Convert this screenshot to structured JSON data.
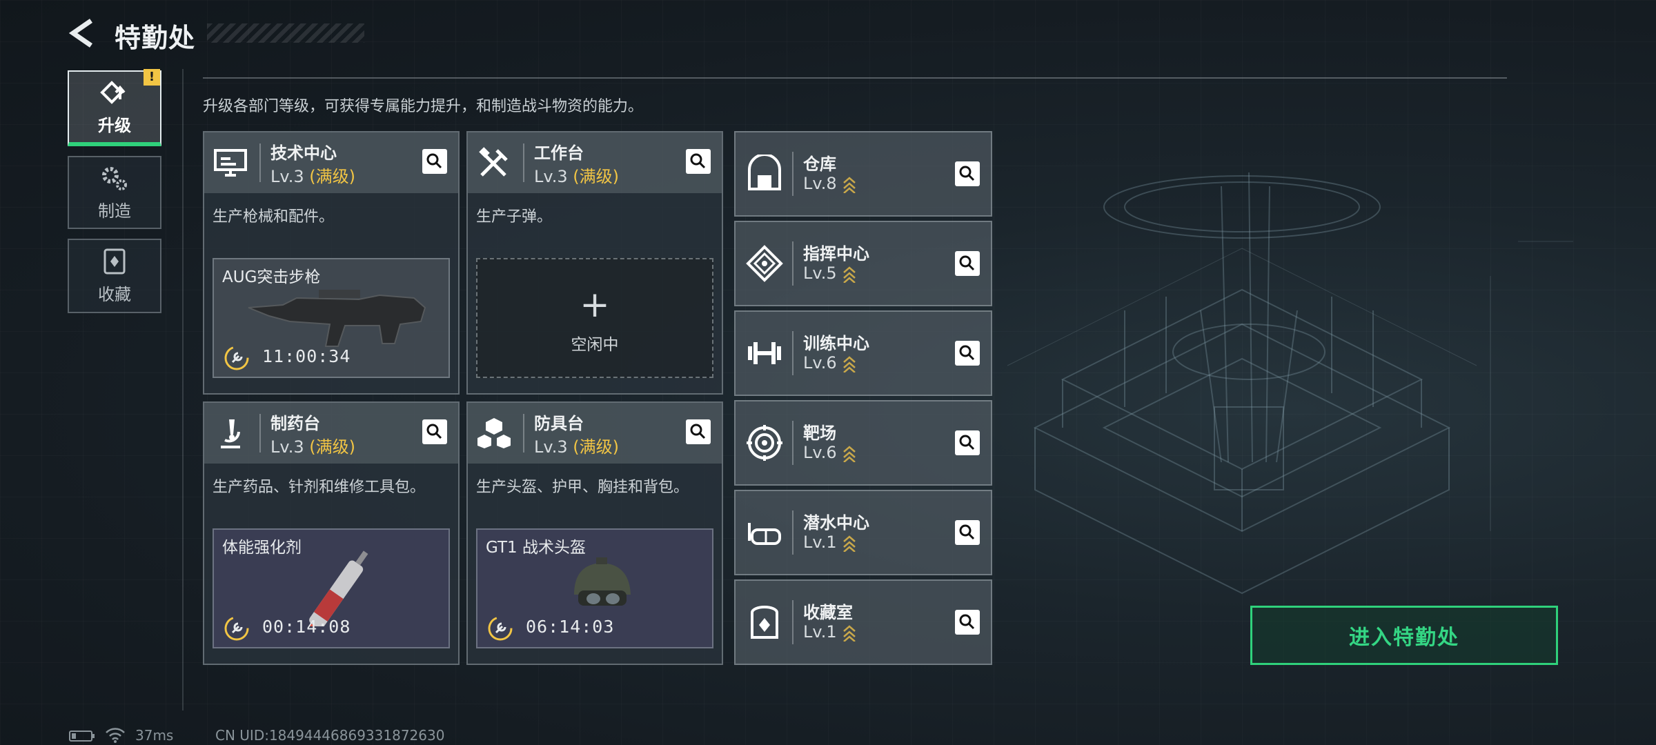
{
  "header": {
    "title": "特勤处",
    "back_icon": "back-arrow-icon"
  },
  "nav": {
    "items": [
      {
        "label": "升级",
        "icon": "upgrade-icon",
        "active": true,
        "warning": "!"
      },
      {
        "label": "制造",
        "icon": "gears-icon",
        "active": false
      },
      {
        "label": "收藏",
        "icon": "collection-icon",
        "active": false
      }
    ]
  },
  "description": "升级各部门等级，可获得专属能力提升，和制造战斗物资的能力。",
  "production_facilities": [
    {
      "name": "技术中心",
      "level": "Lv.3",
      "level_status": "(满级)",
      "icon": "monitor-icon",
      "desc": "生产枪械和配件。",
      "craft": {
        "item": "AUG突击步枪",
        "time": "11:00:34"
      }
    },
    {
      "name": "工作台",
      "level": "Lv.3",
      "level_status": "(满级)",
      "icon": "tools-icon",
      "desc": "生产子弹。",
      "idle": {
        "plus": "+",
        "label": "空闲中"
      }
    },
    {
      "name": "制药台",
      "level": "Lv.3",
      "level_status": "(满级)",
      "icon": "microscope-icon",
      "desc": "生产药品、针剂和维修工具包。",
      "craft": {
        "item": "体能强化剂",
        "time": "00:14:08"
      }
    },
    {
      "name": "防具台",
      "level": "Lv.3",
      "level_status": "(满级)",
      "icon": "cubes-icon",
      "desc": "生产头盔、护甲、胸挂和背包。",
      "craft": {
        "item": "GT1 战术头盔",
        "time": "06:14:03"
      }
    }
  ],
  "other_facilities": [
    {
      "name": "仓库",
      "level": "Lv.8",
      "icon": "warehouse-icon"
    },
    {
      "name": "指挥中心",
      "level": "Lv.5",
      "icon": "command-icon"
    },
    {
      "name": "训练中心",
      "level": "Lv.6",
      "icon": "dumbbell-icon"
    },
    {
      "name": "靶场",
      "level": "Lv.6",
      "icon": "target-icon"
    },
    {
      "name": "潜水中心",
      "level": "Lv.1",
      "icon": "diving-mask-icon"
    },
    {
      "name": "收藏室",
      "level": "Lv.1",
      "icon": "collection-room-icon"
    }
  ],
  "enter_button": "进入特勤处",
  "status_bar": {
    "ping": "37ms",
    "uid": "CN UID:18494446869331872630"
  },
  "colors": {
    "accent_green": "#2fd17b",
    "max_level_gold": "#f2c544",
    "upgrade_chevron": "#c9a84a"
  }
}
